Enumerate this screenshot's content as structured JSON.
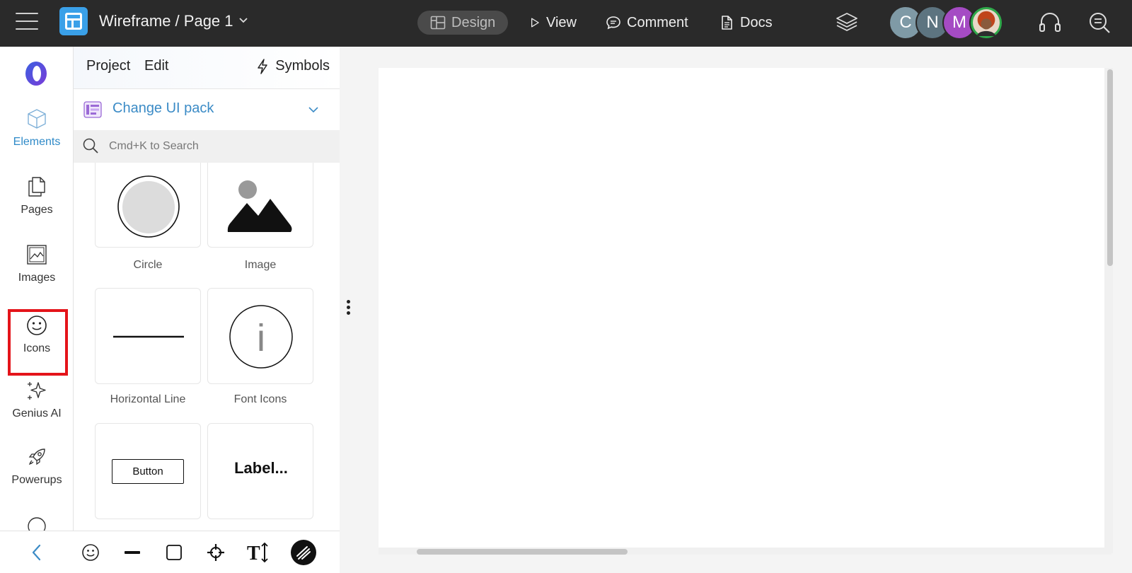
{
  "topbar": {
    "title": "Wireframe / Page 1",
    "nav": [
      {
        "label": "Design",
        "icon": "layout-icon",
        "active": true
      },
      {
        "label": "View",
        "icon": "play-icon",
        "active": false
      },
      {
        "label": "Comment",
        "icon": "comment-icon",
        "active": false
      },
      {
        "label": "Docs",
        "icon": "document-icon",
        "active": false
      }
    ],
    "avatars": [
      {
        "initial": "C",
        "color": "#7f9aa6"
      },
      {
        "initial": "N",
        "color": "#5d7480"
      },
      {
        "initial": "M",
        "color": "#a54bc4"
      },
      {
        "initial": "",
        "color": "#d9652b",
        "ring": "#2eaa4a"
      }
    ]
  },
  "rail": {
    "items": [
      {
        "label": "Elements",
        "icon": "cube-icon",
        "active": true
      },
      {
        "label": "Pages",
        "icon": "pages-icon"
      },
      {
        "label": "Images",
        "icon": "image-icon"
      },
      {
        "label": "Icons",
        "icon": "smiley-icon",
        "highlighted": true
      },
      {
        "label": "Genius AI",
        "icon": "sparkle-icon"
      },
      {
        "label": "Powerups",
        "icon": "rocket-icon"
      }
    ]
  },
  "panel": {
    "tabs": [
      "Project",
      "Edit"
    ],
    "symbols_label": "Symbols",
    "ui_pack_label": "Change UI pack",
    "search_placeholder": "Cmd+K to Search",
    "elements": [
      {
        "label": "Circle"
      },
      {
        "label": "Image"
      },
      {
        "label": "Horizontal Line"
      },
      {
        "label": "Font Icons",
        "glyph": "i"
      },
      {
        "label": "",
        "button_text": "Button"
      },
      {
        "label": "",
        "preview_text": "Label..."
      }
    ],
    "bottom_tools": [
      "smiley-icon",
      "line-icon",
      "square-icon",
      "crosshair-icon",
      "text-size-icon",
      "scribble-icon"
    ]
  },
  "colors": {
    "accent": "#3b8bc6",
    "topbar_bg": "#2a2a2a",
    "highlight": "#e4141a"
  }
}
